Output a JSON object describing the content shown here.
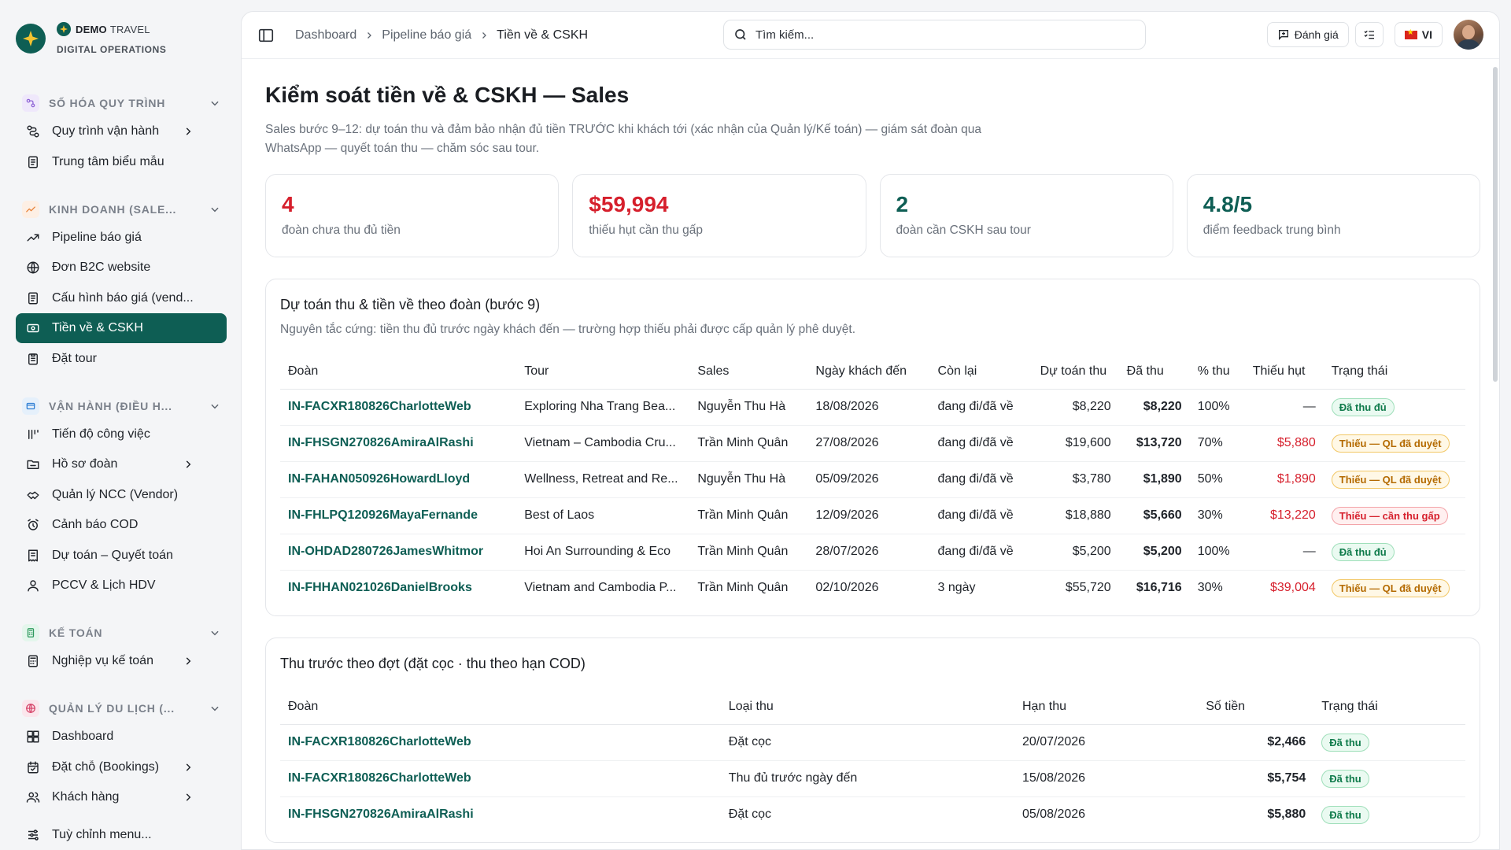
{
  "brand": {
    "name_bold": "DEMO",
    "name_light": "TRAVEL",
    "subtitle": "DIGITAL OPERATIONS"
  },
  "sidebar": {
    "sections": [
      {
        "label": "SỐ HÓA QUY TRÌNH",
        "color": "#8e63d6",
        "bg": "#efe8fb",
        "items": [
          {
            "label": "Quy trình vận hành",
            "icon": "workflow-icon",
            "has_sub": true
          },
          {
            "label": "Trung tâm biểu mẫu",
            "icon": "document-icon",
            "has_sub": false
          }
        ]
      },
      {
        "label": "KINH DOANH (SALE...",
        "color": "#e8833a",
        "bg": "#fdefe4",
        "items": [
          {
            "label": "Pipeline báo giá",
            "icon": "trend-icon",
            "has_sub": false
          },
          {
            "label": "Đơn B2C website",
            "icon": "globe-icon",
            "has_sub": false
          },
          {
            "label": "Cấu hình báo giá (vend...",
            "icon": "document-icon",
            "has_sub": false
          },
          {
            "label": "Tiền về & CSKH",
            "icon": "cash-icon",
            "has_sub": false,
            "active": true
          },
          {
            "label": "Đặt tour",
            "icon": "clipboard-icon",
            "has_sub": false
          }
        ]
      },
      {
        "label": "VẬN HÀNH (ĐIỀU H...",
        "color": "#2f7fd4",
        "bg": "#e5f0fb",
        "items": [
          {
            "label": "Tiến độ công việc",
            "icon": "progress-icon",
            "has_sub": false
          },
          {
            "label": "Hồ sơ đoàn",
            "icon": "folder-icon",
            "has_sub": true
          },
          {
            "label": "Quản lý NCC (Vendor)",
            "icon": "handshake-icon",
            "has_sub": false
          },
          {
            "label": "Cảnh báo COD",
            "icon": "alarm-icon",
            "has_sub": false
          },
          {
            "label": "Dự toán – Quyết toán",
            "icon": "receipt-icon",
            "has_sub": false
          },
          {
            "label": "PCCV & Lịch HDV",
            "icon": "user-icon",
            "has_sub": false
          }
        ]
      },
      {
        "label": "KẾ TOÁN",
        "color": "#2e9a5e",
        "bg": "#e4f6ec",
        "items": [
          {
            "label": "Nghiệp vụ kế toán",
            "icon": "calculator-icon",
            "has_sub": true
          }
        ]
      },
      {
        "label": "QUẢN LÝ DU LỊCH (...",
        "color": "#d6456a",
        "bg": "#fbe6ec",
        "items": [
          {
            "label": "Dashboard",
            "icon": "dashboard-icon",
            "has_sub": false
          },
          {
            "label": "Đặt chỗ (Bookings)",
            "icon": "calendar-icon",
            "has_sub": true
          },
          {
            "label": "Khách hàng",
            "icon": "users-icon",
            "has_sub": true
          }
        ]
      }
    ],
    "customize_label": "Tuỳ chỉnh menu..."
  },
  "topbar": {
    "breadcrumb": [
      "Dashboard",
      "Pipeline báo giá",
      "Tiền về & CSKH"
    ],
    "search_placeholder": "Tìm kiếm...",
    "feedback_label": "Đánh giá",
    "lang_label": "VI"
  },
  "page": {
    "title": "Kiểm soát tiền về & CSKH — Sales",
    "subtitle": "Sales bước 9–12: dự toán thu và đảm bảo nhận đủ tiền TRƯỚC khi khách tới (xác nhận của Quản lý/Kế toán) — giám sát đoàn qua WhatsApp — quyết toán thu — chăm sóc sau tour."
  },
  "stats": [
    {
      "value": "4",
      "label": "đoàn chưa thu đủ tiền",
      "color": "#d61f2c"
    },
    {
      "value": "$59,994",
      "label": "thiếu hụt cần thu gấp",
      "color": "#d61f2c"
    },
    {
      "value": "2",
      "label": "đoàn cần CSKH sau tour",
      "color": "#0e5e54"
    },
    {
      "value": "4.8/5",
      "label": "điểm feedback trung bình",
      "color": "#0e5e54"
    }
  ],
  "revenue_table": {
    "title": "Dự toán thu & tiền về theo đoàn (bước 9)",
    "subtitle": "Nguyên tắc cứng: tiền thu đủ trước ngày khách đến — trường hợp thiếu phải được cấp quản lý phê duyệt.",
    "headers": [
      "Đoàn",
      "Tour",
      "Sales",
      "Ngày khách đến",
      "Còn lại",
      "Dự toán thu",
      "Đã thu",
      "% thu",
      "Thiếu hụt",
      "Trạng thái"
    ],
    "rows": [
      {
        "code": "IN-FACXR180826CharlotteWeb",
        "tour": "Exploring Nha Trang Bea...",
        "sales": "Nguyễn Thu Hà",
        "date": "18/08/2026",
        "remain": "đang đi/đã về",
        "budget": "$8,220",
        "paid": "$8,220",
        "pct": "100%",
        "short": "—",
        "status": "Đã thu đủ",
        "tone": "green"
      },
      {
        "code": "IN-FHSGN270826AmiraAlRashi",
        "tour": "Vietnam – Cambodia Cru...",
        "sales": "Trần Minh Quân",
        "date": "27/08/2026",
        "remain": "đang đi/đã về",
        "budget": "$19,600",
        "paid": "$13,720",
        "pct": "70%",
        "short": "$5,880",
        "status": "Thiếu — QL đã duyệt",
        "tone": "amber"
      },
      {
        "code": "IN-FAHAN050926HowardLloyd",
        "tour": "Wellness, Retreat and Re...",
        "sales": "Nguyễn Thu Hà",
        "date": "05/09/2026",
        "remain": "đang đi/đã về",
        "budget": "$3,780",
        "paid": "$1,890",
        "pct": "50%",
        "short": "$1,890",
        "status": "Thiếu — QL đã duyệt",
        "tone": "amber"
      },
      {
        "code": "IN-FHLPQ120926MayaFernande",
        "tour": "Best of Laos",
        "sales": "Trần Minh Quân",
        "date": "12/09/2026",
        "remain": "đang đi/đã về",
        "budget": "$18,880",
        "paid": "$5,660",
        "pct": "30%",
        "short": "$13,220",
        "status": "Thiếu — cần thu gấp",
        "tone": "red"
      },
      {
        "code": "IN-OHDAD280726JamesWhitmor",
        "tour": "Hoi An Surrounding & Eco",
        "sales": "Trần Minh Quân",
        "date": "28/07/2026",
        "remain": "đang đi/đã về",
        "budget": "$5,200",
        "paid": "$5,200",
        "pct": "100%",
        "short": "—",
        "status": "Đã thu đủ",
        "tone": "green"
      },
      {
        "code": "IN-FHHAN021026DanielBrooks",
        "tour": "Vietnam and Cambodia P...",
        "sales": "Trần Minh Quân",
        "date": "02/10/2026",
        "remain": "3 ngày",
        "budget": "$55,720",
        "paid": "$16,716",
        "pct": "30%",
        "short": "$39,004",
        "status": "Thiếu — QL đã duyệt",
        "tone": "amber"
      }
    ]
  },
  "installment_table": {
    "title": "Thu trước theo đợt (đặt cọc · thu theo hạn COD)",
    "headers": [
      "Đoàn",
      "Loại thu",
      "Hạn thu",
      "Số tiền",
      "Trạng thái"
    ],
    "rows": [
      {
        "code": "IN-FACXR180826CharlotteWeb",
        "type": "Đặt cọc",
        "due": "20/07/2026",
        "amount": "$2,466",
        "status": "Đã thu"
      },
      {
        "code": "IN-FACXR180826CharlotteWeb",
        "type": "Thu đủ trước ngày đến",
        "due": "15/08/2026",
        "amount": "$5,754",
        "status": "Đã thu"
      },
      {
        "code": "IN-FHSGN270826AmiraAlRashi",
        "type": "Đặt cọc",
        "due": "05/08/2026",
        "amount": "$5,880",
        "status": "Đã thu"
      }
    ]
  }
}
